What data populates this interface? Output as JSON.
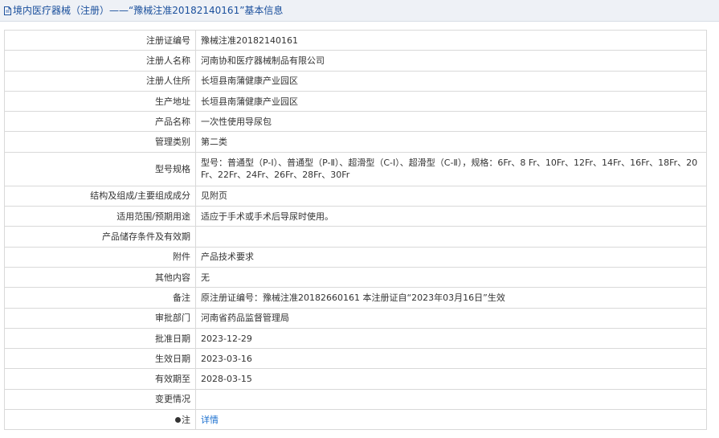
{
  "header": {
    "title": "境内医疗器械（注册）——“豫械注准20182140161”基本信息"
  },
  "rows": [
    {
      "label": "注册证编号",
      "value": "豫械注准20182140161"
    },
    {
      "label": "注册人名称",
      "value": "河南协和医疗器械制品有限公司"
    },
    {
      "label": "注册人住所",
      "value": "长垣县南蒲健康产业园区"
    },
    {
      "label": "生产地址",
      "value": "长垣县南蒲健康产业园区"
    },
    {
      "label": "产品名称",
      "value": "一次性使用导尿包"
    },
    {
      "label": "管理类别",
      "value": "第二类"
    },
    {
      "label": "型号规格",
      "value": "型号：普通型（P-Ⅰ）、普通型（P-Ⅱ）、超滑型（C-Ⅰ）、超滑型（C-Ⅱ），规格：6Fr、8 Fr、10Fr、12Fr、14Fr、16Fr、18Fr、20Fr、22Fr、24Fr、26Fr、28Fr、30Fr"
    },
    {
      "label": "结构及组成/主要组成成分",
      "value": "见附页"
    },
    {
      "label": "适用范围/预期用途",
      "value": "适应于手术或手术后导尿时使用。"
    },
    {
      "label": "产品储存条件及有效期",
      "value": ""
    },
    {
      "label": "附件",
      "value": "产品技术要求"
    },
    {
      "label": "其他内容",
      "value": "无"
    },
    {
      "label": "备注",
      "value": "原注册证编号：豫械注准20182660161 本注册证自“2023年03月16日”生效"
    },
    {
      "label": "审批部门",
      "value": "河南省药品监督管理局"
    },
    {
      "label": "批准日期",
      "value": "2023-12-29"
    },
    {
      "label": "生效日期",
      "value": "2023-03-16"
    },
    {
      "label": "有效期至",
      "value": "2028-03-15"
    },
    {
      "label": "变更情况",
      "value": ""
    }
  ],
  "note": {
    "label": "注",
    "link_text": "详情"
  },
  "colors": {
    "title_text": "#1a4f9c",
    "title_bg": "#eef1f6",
    "link": "#1a6fcf",
    "border": "#d9d9d9"
  }
}
